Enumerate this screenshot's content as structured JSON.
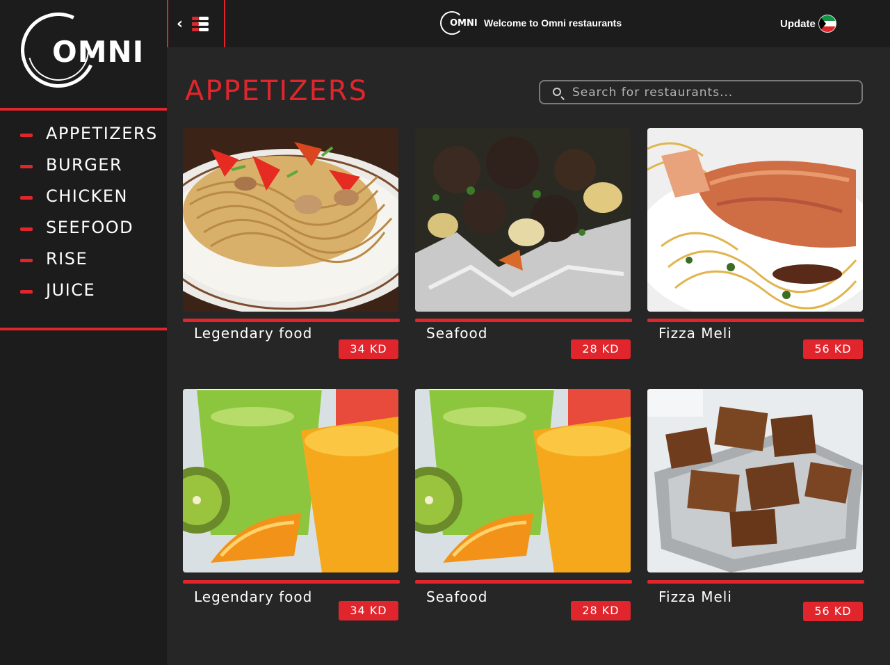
{
  "brand": {
    "logo_text": "OMNI",
    "mini_logo_text": "OMNI"
  },
  "topbar": {
    "welcome": "Welcome to Omni restaurants",
    "update_label": "Update"
  },
  "sidebar": {
    "items": [
      {
        "label": "APPETIZERS"
      },
      {
        "label": "BURGER"
      },
      {
        "label": "CHICKEN"
      },
      {
        "label": "SEEFOOD"
      },
      {
        "label": "RISE"
      },
      {
        "label": "JUICE"
      }
    ]
  },
  "main": {
    "title": "APPETIZERS",
    "search_placeholder": "Search for restaurants..."
  },
  "cards": [
    {
      "name": "Legendary food",
      "price": "34 KD",
      "image": "noodles-stirfry"
    },
    {
      "name": "Seafood",
      "price": "28 KD",
      "image": "roasted-meat-foil"
    },
    {
      "name": "Fizza Meli",
      "price": "56 KD",
      "image": "salmon-pasta"
    },
    {
      "name": "Legendary food",
      "price": "34 KD",
      "image": "juice-glasses"
    },
    {
      "name": "Seafood",
      "price": "28 KD",
      "image": "juice-glasses"
    },
    {
      "name": "Fizza Meli",
      "price": "56 KD",
      "image": "brownies-tray"
    }
  ],
  "colors": {
    "accent": "#e0262c",
    "background": "#262626",
    "sidebar": "#1c1c1c"
  }
}
